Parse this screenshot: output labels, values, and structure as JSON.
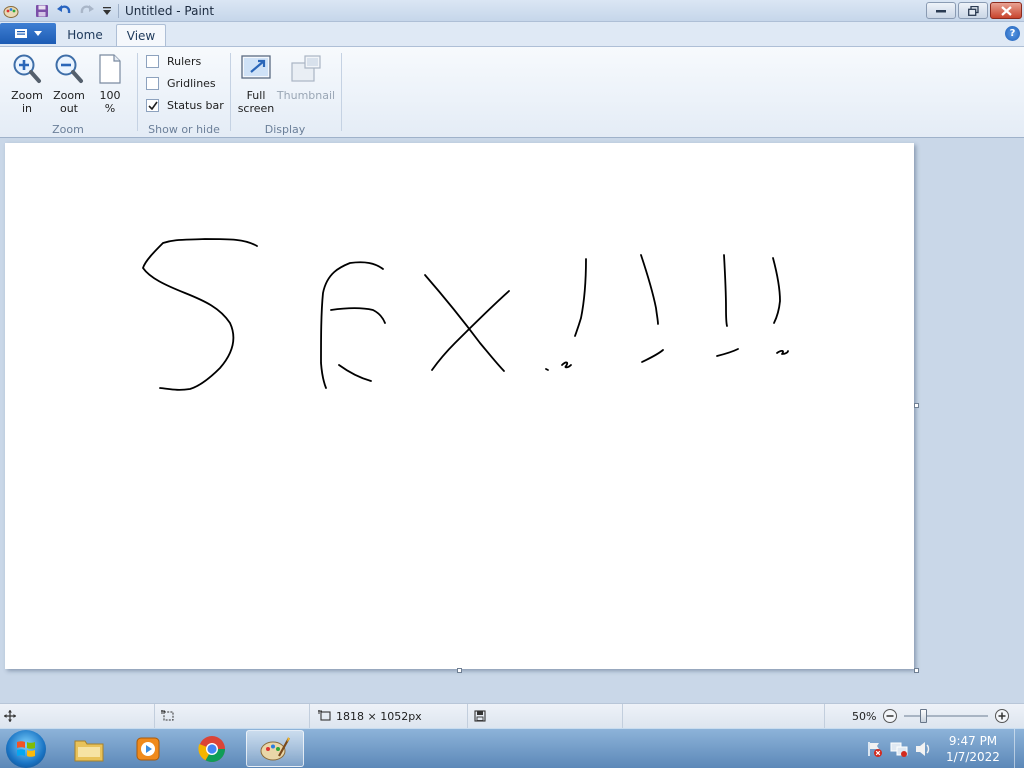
{
  "window": {
    "title": "Untitled - Paint"
  },
  "ribbon": {
    "tabs": [
      {
        "label": "Home"
      },
      {
        "label": "View"
      }
    ],
    "groups": {
      "zoom": {
        "label": "Zoom",
        "buttons": [
          {
            "label": "Zoom\nin",
            "icon": "zoom-in-icon"
          },
          {
            "label": "Zoom\nout",
            "icon": "zoom-out-icon"
          },
          {
            "label": "100\n%",
            "icon": "page-icon"
          }
        ]
      },
      "show_hide": {
        "label": "Show or hide",
        "checkboxes": [
          {
            "label": "Rulers",
            "checked": false
          },
          {
            "label": "Gridlines",
            "checked": false
          },
          {
            "label": "Status bar",
            "checked": true
          }
        ]
      },
      "display": {
        "label": "Display",
        "buttons": [
          {
            "label": "Full\nscreen",
            "icon": "full-screen-icon",
            "enabled": true
          },
          {
            "label": "Thumbnail",
            "icon": "thumbnail-icon",
            "enabled": false
          }
        ]
      }
    }
  },
  "canvas": {
    "drawing_note_strokes": "S E X ! ! ! !"
  },
  "statusbar": {
    "dimensions": "1818 × 1052px",
    "zoom": "50%"
  },
  "taskbar": {
    "clock_time": "9:47 PM",
    "clock_date": "1/7/2022"
  },
  "colors": {
    "accent": "#1d5cb4",
    "workspace": "#c9d7e8"
  }
}
